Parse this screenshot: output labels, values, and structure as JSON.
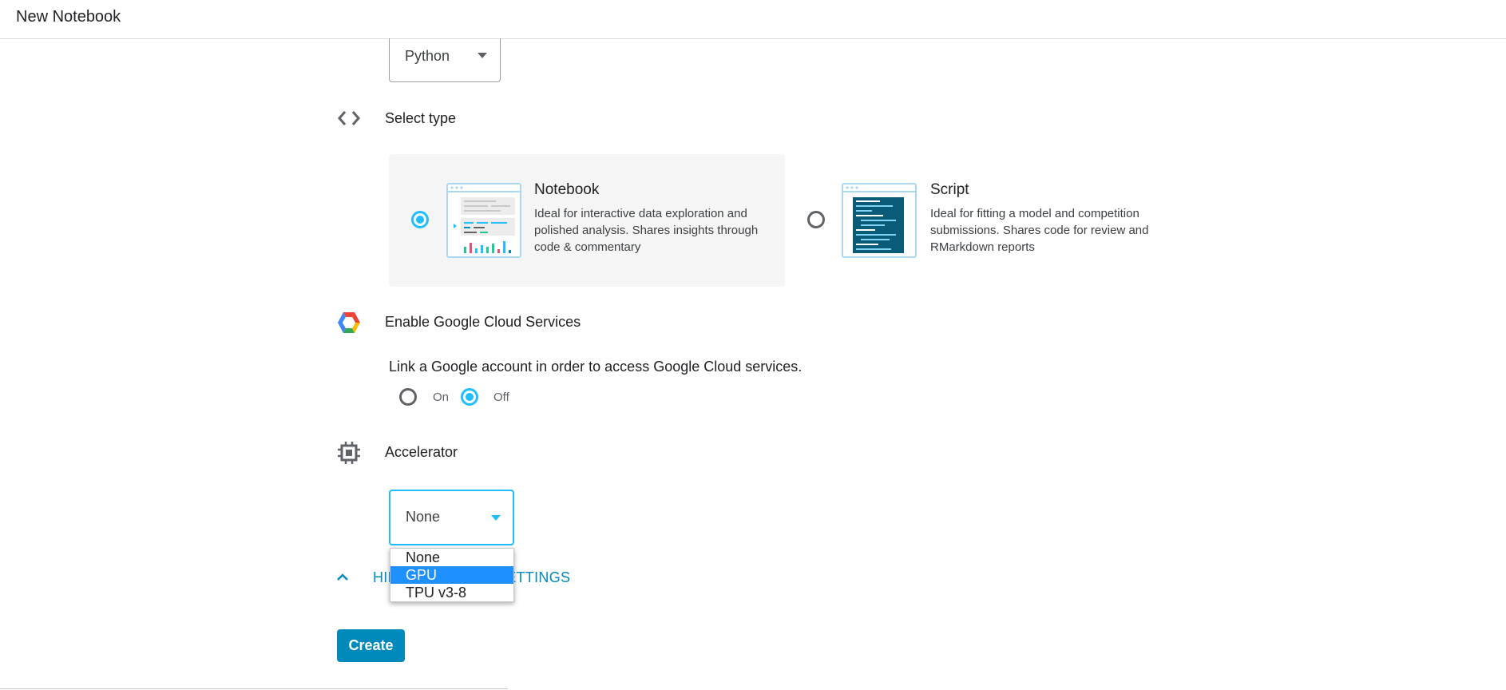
{
  "header": {
    "title": "New Notebook"
  },
  "language": {
    "selected": "Python"
  },
  "select_type": {
    "label": "Select type",
    "options": [
      {
        "title": "Notebook",
        "description": "Ideal for interactive data exploration and polished analysis. Shares insights through code & commentary",
        "selected": true
      },
      {
        "title": "Script",
        "description": "Ideal for fitting a model and competition submissions. Shares code for review and RMarkdown reports",
        "selected": false
      }
    ]
  },
  "gcs": {
    "label": "Enable Google Cloud Services",
    "description": "Link a Google account in order to access Google Cloud services.",
    "on_label": "On",
    "off_label": "Off",
    "selected": "Off"
  },
  "accelerator": {
    "label": "Accelerator",
    "selected": "None",
    "options": [
      "None",
      "GPU",
      "TPU v3-8"
    ],
    "highlighted": "GPU"
  },
  "advanced": {
    "link_label": "HIDE ADVANCED SETTINGS"
  },
  "actions": {
    "create_label": "Create"
  },
  "colors": {
    "accent": "#20beff",
    "link": "#008abc",
    "button": "#008abc",
    "highlight": "#1e90ff"
  },
  "icons": [
    "code-brackets-icon",
    "google-cloud-icon",
    "chip-icon",
    "chevron-up-icon",
    "chevron-down-icon"
  ]
}
